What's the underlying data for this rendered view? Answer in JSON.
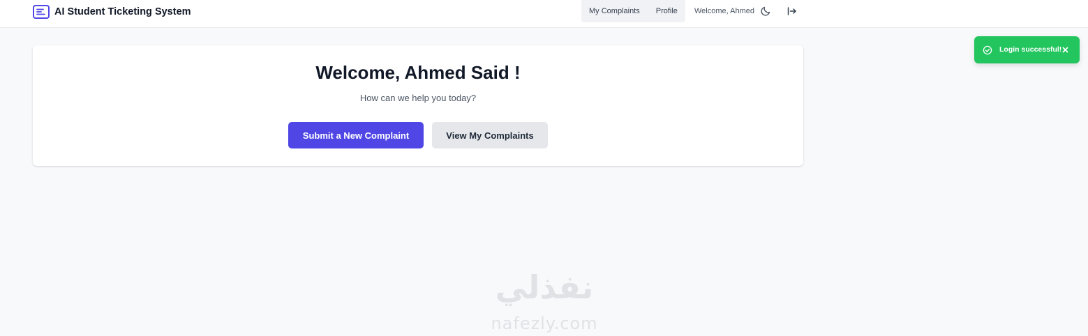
{
  "app": {
    "title": "AI Student Ticketing System",
    "brand_icon": "ticket-list-icon"
  },
  "nav": {
    "links": [
      {
        "label": "My Complaints"
      },
      {
        "label": "Profile"
      }
    ],
    "welcome": "Welcome, Ahmed",
    "theme_icon": "moon-icon",
    "logout_icon": "logout-icon"
  },
  "toast": {
    "message": "Login successful!",
    "icon": "check-circle-icon",
    "close_icon": "close-icon",
    "color": "#22c55e"
  },
  "hero": {
    "title": "Welcome, Ahmed Said !",
    "subtitle": "How can we help you today?",
    "primary_button": "Submit a New Complaint",
    "secondary_button": "View My Complaints"
  },
  "watermark": {
    "arabic": "نفذلي",
    "latin": "nafezly.com"
  },
  "colors": {
    "accent": "#4f46e5",
    "success": "#22c55e",
    "background": "#f8f9fb"
  }
}
